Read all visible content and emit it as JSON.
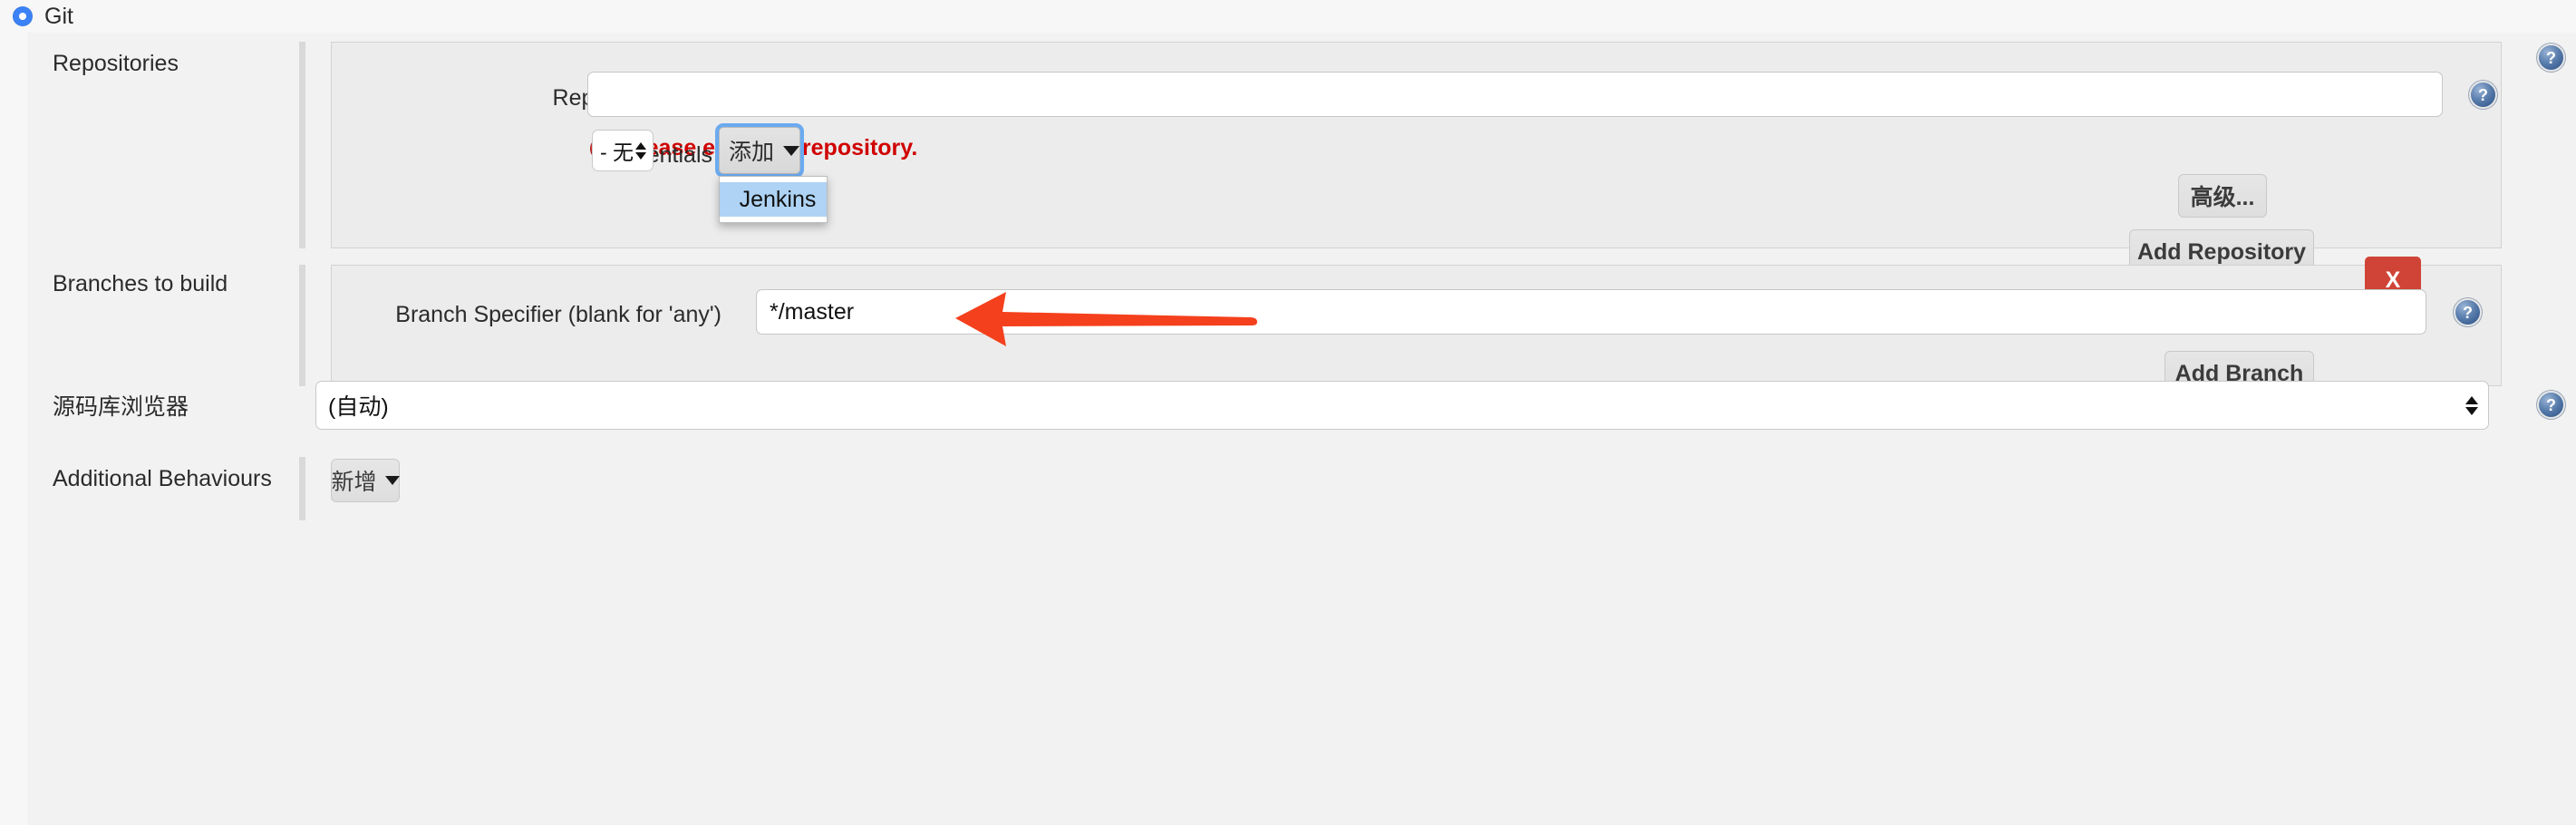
{
  "scm": {
    "selected_option_label": "Git",
    "radio_icon": "radio-selected-icon"
  },
  "sections": {
    "repositories": {
      "label": "Repositories",
      "repository_url": {
        "label": "Repository URL",
        "value": "",
        "placeholder": ""
      },
      "error": {
        "icon": "error-circle-icon",
        "text": "Please enter Git repository."
      },
      "credentials": {
        "label": "Credentials",
        "select_value": "- 无 -",
        "add_button": {
          "label": "添加",
          "icon": "key-icon",
          "caret_icon": "caret-down-icon"
        },
        "dropdown": {
          "items": [
            {
              "label": "Jenkins",
              "icon": "jenkins-house-icon"
            }
          ]
        }
      },
      "advanced_button_label": "高级...",
      "add_repository_button_label": "Add Repository",
      "help_icon": "help-icon"
    },
    "branches": {
      "label": "Branches to build",
      "delete_button_label": "X",
      "branch_specifier": {
        "label": "Branch Specifier (blank for 'any')",
        "value": "*/master"
      },
      "add_branch_button_label": "Add Branch",
      "help_icon": "help-icon"
    },
    "repository_browser": {
      "label": "源码库浏览器",
      "select_value": "(自动)",
      "help_icon": "help-icon"
    },
    "additional_behaviours": {
      "label": "Additional Behaviours",
      "add_button_label": "新增",
      "caret_icon": "caret-down-icon"
    }
  },
  "annotation": {
    "arrow": "red-left-arrow",
    "color": "#f4401c"
  },
  "colors": {
    "accent_blue": "#3b82f6",
    "focus_ring": "#6aaaf0",
    "error_red": "#d00000",
    "danger_button": "#cf4436",
    "menu_highlight": "#aed3f4",
    "panel_bg": "#ececec",
    "page_bg": "#f2f2f2"
  }
}
